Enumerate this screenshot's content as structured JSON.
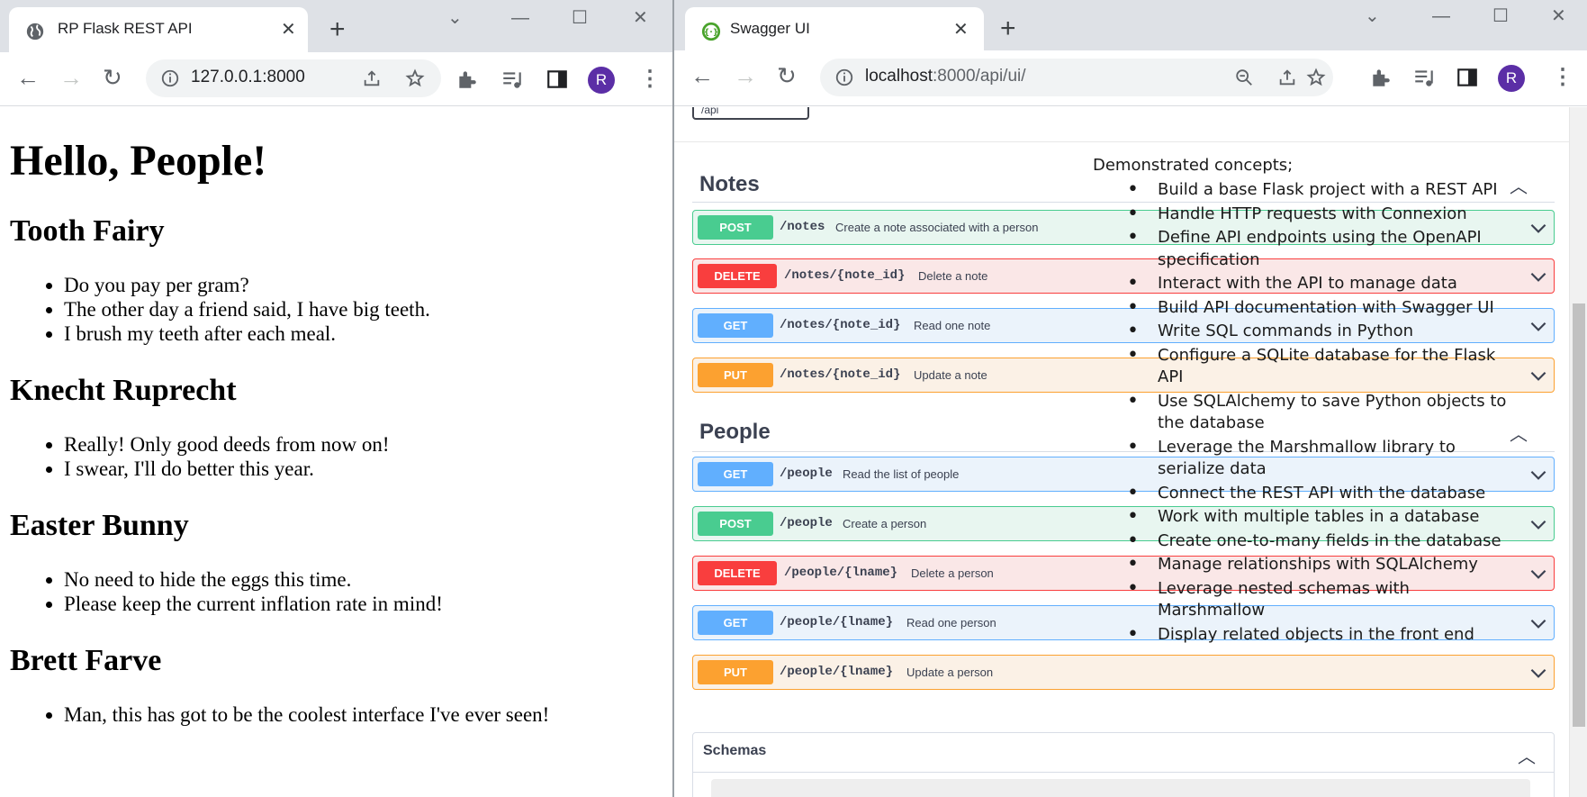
{
  "left_browser": {
    "tab_title": "RP Flask REST API",
    "url": "127.0.0.1:8000",
    "avatar_letter": "R",
    "page": {
      "title": "Hello, People!",
      "people": [
        {
          "name": "Tooth Fairy",
          "notes": [
            "Do you pay per gram?",
            "The other day a friend said, I have big teeth.",
            "I brush my teeth after each meal."
          ]
        },
        {
          "name": "Knecht Ruprecht",
          "notes": [
            "Really! Only good deeds from now on!",
            "I swear, I'll do better this year."
          ]
        },
        {
          "name": "Easter Bunny",
          "notes": [
            "No need to hide the eggs this time.",
            "Please keep the current inflation rate in mind!"
          ]
        },
        {
          "name": "Brett Farve",
          "notes": [
            "Man, this has got to be the coolest interface I've ever seen!"
          ]
        }
      ]
    }
  },
  "right_browser": {
    "tab_title": "Swagger UI",
    "url_host": "localhost",
    "url_rest": ":8000/api/ui/",
    "avatar_letter": "R",
    "api_selector_text": "/api",
    "sections": [
      {
        "title": "Notes",
        "operations": [
          {
            "method": "POST",
            "path": "/notes",
            "summary": "Create a note associated with a person"
          },
          {
            "method": "DELETE",
            "path": "/notes/{note_id}",
            "summary": "Delete a note"
          },
          {
            "method": "GET",
            "path": "/notes/{note_id}",
            "summary": "Read one note"
          },
          {
            "method": "PUT",
            "path": "/notes/{note_id}",
            "summary": "Update a note"
          }
        ]
      },
      {
        "title": "People",
        "operations": [
          {
            "method": "GET",
            "path": "/people",
            "summary": "Read the list of people"
          },
          {
            "method": "POST",
            "path": "/people",
            "summary": "Create a person"
          },
          {
            "method": "DELETE",
            "path": "/people/{lname}",
            "summary": "Delete a person"
          },
          {
            "method": "GET",
            "path": "/people/{lname}",
            "summary": "Read one person"
          },
          {
            "method": "PUT",
            "path": "/people/{lname}",
            "summary": "Update a person"
          }
        ]
      }
    ],
    "schemas_title": "Schemas"
  },
  "overlay": {
    "heading": "Demonstrated concepts;",
    "items": [
      "Build a base Flask project with a REST API",
      "Handle HTTP requests with Connexion",
      "Define API endpoints using the OpenAPI specification",
      "Interact with the API to manage data",
      "Build API documentation with Swagger UI",
      "Write SQL commands in Python",
      "Configure a SQLite database for the Flask API",
      "Use SQLAlchemy to save Python objects to the database",
      "Leverage the Marshmallow library to serialize data",
      "Connect the REST API with the database",
      "Work with multiple tables in a database",
      "Create one-to-many fields in the database",
      "Manage relationships with SQLAlchemy",
      "Leverage nested schemas with Marshmallow",
      "Display related objects in the front end"
    ]
  },
  "colors": {
    "post": "#49cc90",
    "delete": "#f93e3e",
    "get": "#61affe",
    "put": "#fca130",
    "avatar": "#5b2ea6",
    "tabstrip": "#dee1e6"
  }
}
